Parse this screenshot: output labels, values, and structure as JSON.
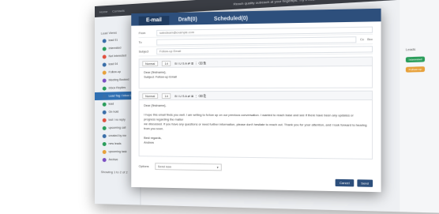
{
  "app": {
    "announcement": "Reach quality outreach at your fingertips. Try it free.",
    "nav": [
      "Home",
      "Contacts"
    ],
    "sidebar_title": "Lead Views",
    "sidebar_items": [
      {
        "label": "lead 01",
        "color": "#3a6ea8"
      },
      {
        "label": "Interested",
        "color": "#2a9d5b"
      },
      {
        "label": "Not Interested",
        "color": "#e0513f"
      },
      {
        "label": "lead 04",
        "color": "#3a6ea8"
      },
      {
        "label": "Follow-up",
        "color": "#e7a13b"
      },
      {
        "label": "Meeting Booked",
        "color": "#7b4fc3"
      },
      {
        "label": "Inbox Replies",
        "color": "#2a9d5b"
      },
      {
        "label": "Lead Tag / Inbox Leads",
        "color": "#3a6ea8",
        "active": true
      },
      {
        "label": "lead",
        "color": "#2a9d5b"
      },
      {
        "label": "On-hold",
        "color": "#3a6ea8"
      },
      {
        "label": "lost / no reply",
        "color": "#e0513f"
      },
      {
        "label": "upcoming call",
        "color": "#2a9d5b"
      },
      {
        "label": "created by me",
        "color": "#3a6ea8"
      },
      {
        "label": "new leads",
        "color": "#2a9d5b"
      },
      {
        "label": "upcoming task",
        "color": "#e7a13b"
      },
      {
        "label": "Archive",
        "color": "#7b4fc3"
      }
    ],
    "pagination": "Showing 1 to 2 of 2",
    "right": {
      "header": "Leads",
      "badge1": "Interested",
      "badge2": "Follow-up"
    }
  },
  "modal": {
    "tabs": [
      "E-mail",
      "Draft(0)",
      "Scheduled(0)"
    ],
    "from_label": "From",
    "from_value": "salesteam@example.com",
    "to_label": "To",
    "cc": "Cc",
    "bcc": "Bcc",
    "subject_label": "Subject",
    "subject_value": "Follow-up Email",
    "toolbar": {
      "style": "Normal",
      "size": "14",
      "buttons": "B  I  U  S  A  ⇄  ≣  ⋮  ⌫  ⎘"
    },
    "preview_line1": "Dear {firstname},",
    "preview_line2": "Subject:",
    "preview_subject": "Follow-up Email",
    "body": [
      "Dear {firstname},",
      "",
      "I hope this email finds you well. I am writing to follow up on our previous conversation. I wanted to reach base and see if there have been any updates or progress regarding the matter",
      "we discussed. If you have any questions or need further information, please don't hesitate to reach out. Thank you for your attention, and I look forward to hearing from you soon.",
      "",
      "Best regards,",
      "Andrew"
    ],
    "options_label": "Options",
    "options_value": "Send now",
    "cancel": "Cancel",
    "send": "Send"
  }
}
